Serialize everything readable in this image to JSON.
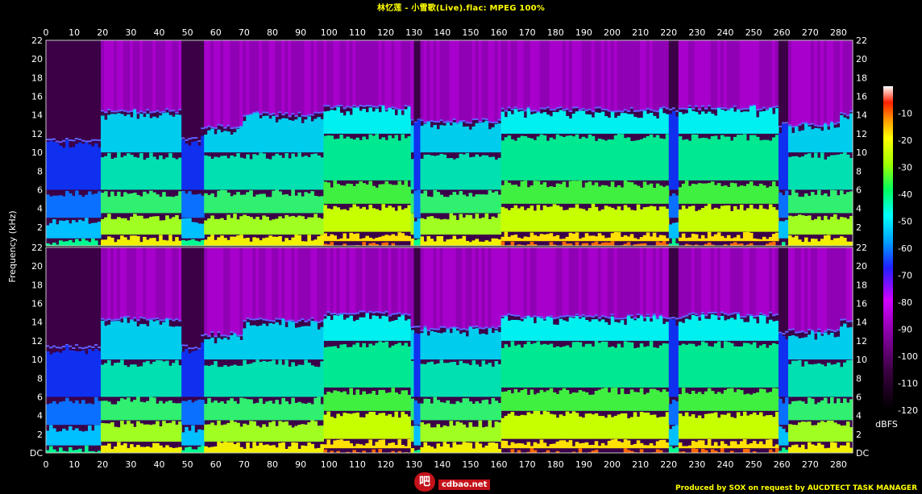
{
  "title": "林忆莲 - 小雪歌(Live).flac: MPEG 100%",
  "credit": "Produced by SOX on request by AUCDTECT TASK MANAGER",
  "watermark": {
    "site": "cdbao.net",
    "mark": "吧"
  },
  "colors": {
    "title": "#ffff00",
    "credit": "#ffff00",
    "background": "#000000",
    "axis_text": "#ffffff"
  },
  "chart_data": {
    "type": "heatmap",
    "title": "林忆莲 - 小雪歌(Live).flac: MPEG 100%",
    "ylabel": "Frequency (kHz)",
    "xlabel": "",
    "x_ticks": [
      "0",
      "10",
      "20",
      "30",
      "40",
      "50",
      "60",
      "70",
      "80",
      "90",
      "100",
      "110",
      "120",
      "130",
      "140",
      "150",
      "160",
      "170",
      "180",
      "190",
      "200",
      "210",
      "220",
      "230",
      "240",
      "250",
      "260",
      "270",
      "280"
    ],
    "y_ticks": [
      "DC",
      "2",
      "4",
      "6",
      "8",
      "10",
      "12",
      "14",
      "16",
      "18",
      "20",
      "22"
    ],
    "xlim": [
      0,
      285
    ],
    "ylim": [
      0,
      22
    ],
    "channels": 2,
    "colorbar": {
      "label": "dBFS",
      "ticks": [
        "-10",
        "-20",
        "-30",
        "-40",
        "-50",
        "-60",
        "-70",
        "-80",
        "-90",
        "-100",
        "-110",
        "-120"
      ],
      "range": [
        -120,
        0
      ]
    },
    "cutoff_khz": {
      "x_start": [
        0,
        19,
        47,
        54,
        69,
        98,
        128,
        160,
        224,
        258,
        280
      ],
      "x_end": [
        19,
        47,
        54,
        69,
        98,
        128,
        160,
        224,
        258,
        280,
        285
      ],
      "left": [
        11.3,
        14.4,
        11.4,
        12.8,
        14.1,
        14.8,
        13.4,
        14.6,
        14.8,
        13.0,
        14.2
      ],
      "right": [
        11.4,
        14.4,
        11.4,
        12.7,
        14.2,
        14.9,
        13.3,
        14.6,
        14.8,
        13.0,
        14.2
      ]
    },
    "quiet_regions_s": [
      [
        0,
        19
      ],
      [
        47,
        55
      ],
      [
        129,
        132
      ],
      [
        219,
        223
      ],
      [
        258,
        262
      ]
    ],
    "loud_regions_s": [
      [
        98,
        128
      ],
      [
        160,
        220
      ],
      [
        223,
        258
      ]
    ]
  }
}
